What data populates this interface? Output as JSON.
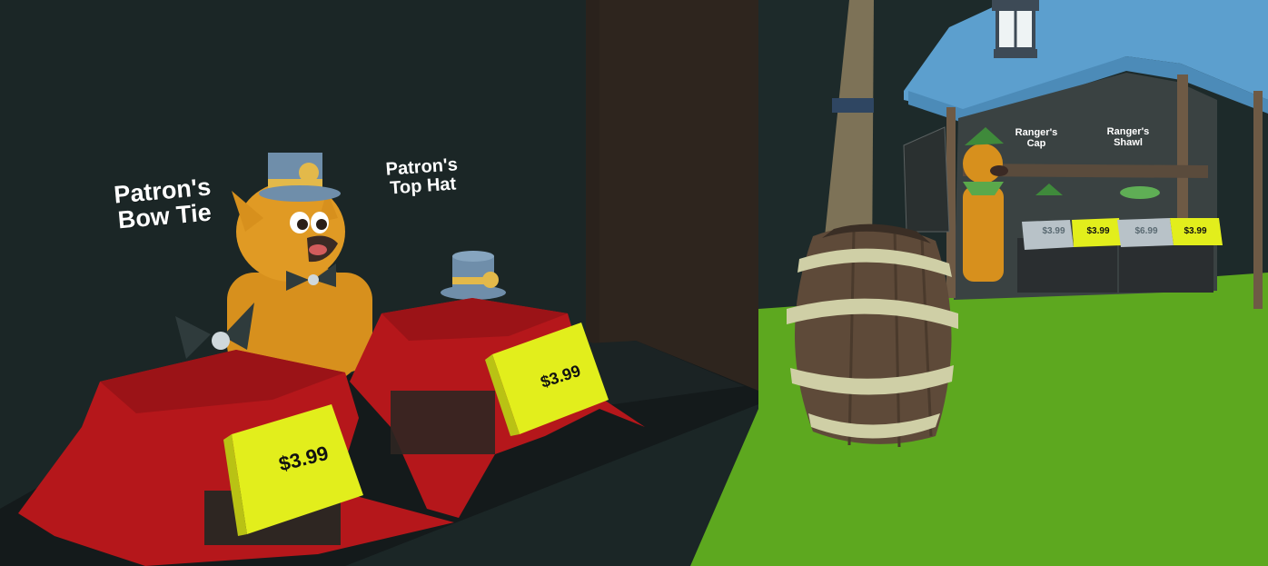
{
  "left_shop": {
    "items": [
      {
        "name": "Patron's\nBow Tie",
        "price": "$3.99"
      },
      {
        "name": "Patron's\nTop Hat",
        "price": "$3.99"
      }
    ]
  },
  "right_shop": {
    "items": [
      {
        "name": "Ranger's\nCap"
      },
      {
        "name": "Ranger's\nShawl"
      }
    ],
    "price_tags": [
      "$3.99",
      "$3.99",
      "$6.99",
      "$3.99"
    ]
  },
  "colors": {
    "wall": "#1b2626",
    "ground": "#5da81f",
    "cloth": "#b5171b",
    "price_tag": "#e2ee1c",
    "roof": "#5c9fce",
    "barrel_wood": "#5e4a39",
    "barrel_band": "#cfcfa6"
  },
  "icons": [
    "fox-vendor-icon",
    "top-hat-icon",
    "bow-tie-icon",
    "barrel-icon",
    "lantern-icon",
    "ranger-cap-icon",
    "ranger-shawl-icon"
  ]
}
